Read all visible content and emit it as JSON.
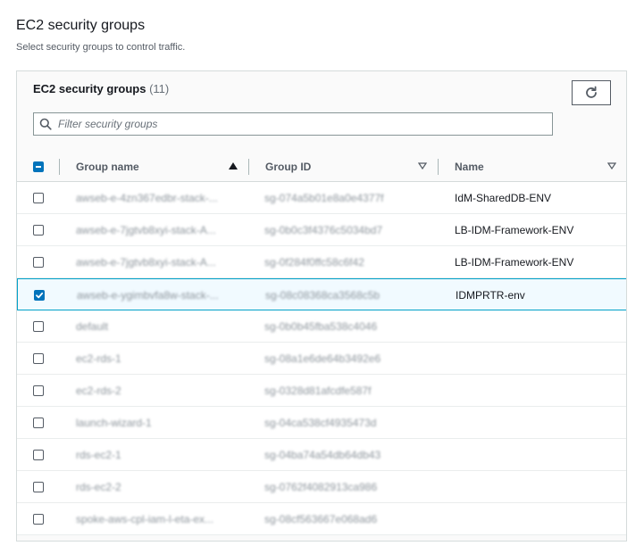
{
  "header": {
    "title": "EC2 security groups",
    "description": "Select security groups to control traffic."
  },
  "panel": {
    "title": "EC2 security groups",
    "count": "(11)",
    "filter_placeholder": "Filter security groups"
  },
  "columns": {
    "group_name": "Group name",
    "group_id": "Group ID",
    "name": "Name",
    "sorted_column": "group_name",
    "sort_direction": "ascending"
  },
  "rows": [
    {
      "group_name": "awseb-e-4zn367edbr-stack-...",
      "group_id": "sg-074a5b01e8a0e4377f",
      "name": "IdM-SharedDB-ENV",
      "selected": false
    },
    {
      "group_name": "awseb-e-7jgtvb8xyi-stack-A...",
      "group_id": "sg-0b0c3f4376c5034bd7",
      "name": "LB-IDM-Framework-ENV",
      "selected": false
    },
    {
      "group_name": "awseb-e-7jgtvb8xyi-stack-A...",
      "group_id": "sg-0f284f0ffc58c6f42",
      "name": "LB-IDM-Framework-ENV",
      "selected": false
    },
    {
      "group_name": "awseb-e-ygimbvfa8w-stack-...",
      "group_id": "sg-08c08368ca3568c5b",
      "name": "IDMPRTR-env",
      "selected": true
    },
    {
      "group_name": "default",
      "group_id": "sg-0b0b45fba538c4046",
      "name": "",
      "selected": false
    },
    {
      "group_name": "ec2-rds-1",
      "group_id": "sg-08a1e6de64b3492e6",
      "name": "",
      "selected": false
    },
    {
      "group_name": "ec2-rds-2",
      "group_id": "sg-0328d81afcdfe587f",
      "name": "",
      "selected": false
    },
    {
      "group_name": "launch-wizard-1",
      "group_id": "sg-04ca538cf4935473d",
      "name": "",
      "selected": false
    },
    {
      "group_name": "rds-ec2-1",
      "group_id": "sg-04ba74a54db64db43",
      "name": "",
      "selected": false
    },
    {
      "group_name": "rds-ec2-2",
      "group_id": "sg-0762f4082913ca986",
      "name": "",
      "selected": false
    },
    {
      "group_name": "spoke-aws-cpl-iam-l-eta-ex...",
      "group_id": "sg-08cf563667e068ad6",
      "name": "",
      "selected": false
    }
  ],
  "colors": {
    "accent": "#0073bb",
    "selected_border": "#00a1c9",
    "selected_bg": "#f1faff"
  }
}
